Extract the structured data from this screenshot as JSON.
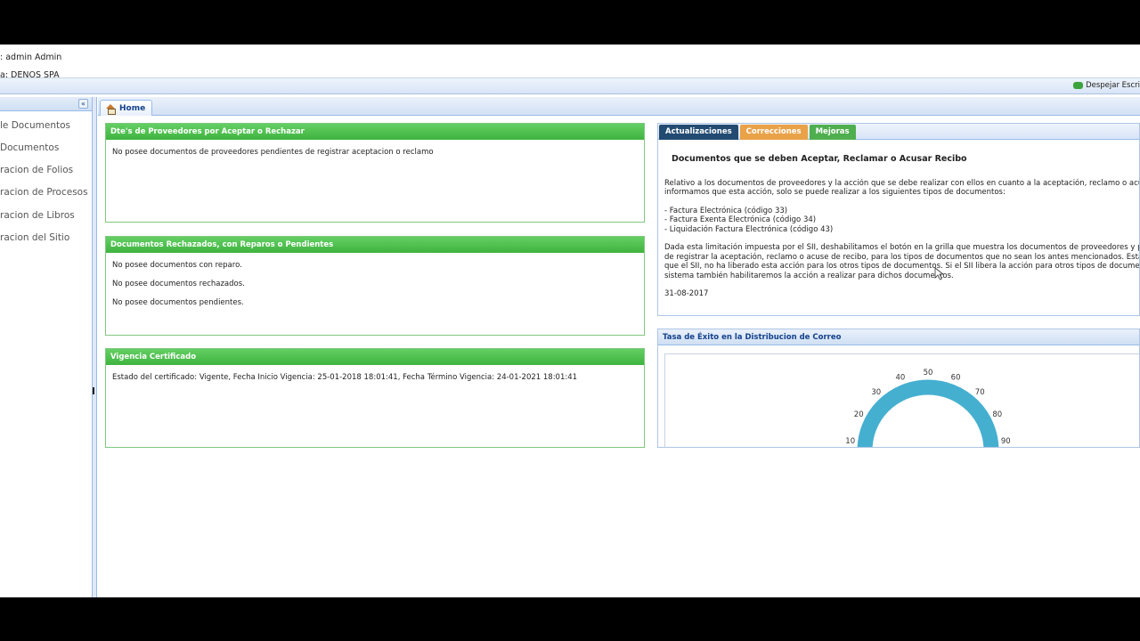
{
  "user": {
    "line1": ": admin Admin",
    "line2": "a: DENOS SPA"
  },
  "toolbar": {
    "despejar_label": "Despejar Escri"
  },
  "sidebar": {
    "collapse_icon": "«",
    "items": [
      {
        "label": "le Documentos"
      },
      {
        "label": "Documentos"
      },
      {
        "label": "racion de Folios"
      },
      {
        "label": "racion de Procesos"
      },
      {
        "label": "racion de Libros"
      },
      {
        "label": "racion del Sitio"
      }
    ]
  },
  "tabs": {
    "home_label": "Home"
  },
  "panels": {
    "proveedores": {
      "title": "Dte's de Proveedores por Aceptar o Rechazar",
      "lines": [
        "No posee documentos de proveedores pendientes de registrar aceptacion o reclamo"
      ]
    },
    "rechazados": {
      "title": "Documentos Rechazados, con Reparos o Pendientes",
      "lines": [
        "No posee documentos con reparo.",
        "No posee documentos rechazados.",
        "No posee documentos pendientes."
      ]
    },
    "certificado": {
      "title": "Vigencia Certificado",
      "lines": [
        "Estado del certificado: Vigente, Fecha Inicio Vigencia: 25-01-2018 18:01:41, Fecha Término Vigencia: 24-01-2021 18:01:41"
      ]
    }
  },
  "updates": {
    "tabs": [
      "Actualizaciones",
      "Correcciones",
      "Mejoras"
    ],
    "title": "Documentos que se deben Aceptar, Reclamar o Acusar Recibo",
    "p1_l1": "Relativo a los documentos de proveedores y la acción que se debe realizar con ellos en cuanto a la aceptación, reclamo o acuse de reci",
    "p1_l2": "informamos que esta acción, solo se puede realizar a los siguientes tipos de documentos:",
    "list": [
      "- Factura Electrónica (código 33)",
      "- Factura Exenta Electrónica (código 34)",
      "- Liquidación Factura Electrónica (código 43)"
    ],
    "p2_l1": "Dada esta limitación impuesta por el SII, deshabilitamos el botón en la grilla que muestra los documentos de proveedores y permite rea",
    "p2_l2": "de registrar la aceptación, reclamo o acuse de recibo, para los tipos de documentos que no sean los antes mencionados. Esta limitación",
    "p2_l3": "que el SII, no ha liberado esta acción para los otros tipos de documentos. Si el SII libera la acción para otros tipos de documentos, en n",
    "p2_l4": "sistema también habilitaremos la acción a realizar para dichos documentos.",
    "date": "31-08-2017"
  },
  "gauge": {
    "title": "Tasa de Éxito en la Distribucion de Correo",
    "ticks": [
      "10",
      "20",
      "30",
      "40",
      "50",
      "60",
      "70",
      "80",
      "90"
    ],
    "color": "#45afd0"
  }
}
